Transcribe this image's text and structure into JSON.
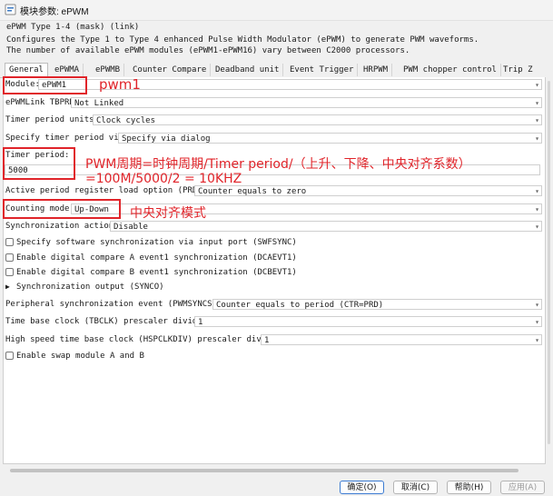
{
  "window": {
    "title": "模块参数: ePWM"
  },
  "mask": {
    "header": "ePWM Type 1-4 (mask) (link)",
    "desc1": "Configures the Type 1 to Type 4 enhanced Pulse Width Modulator (ePWM) to generate PWM waveforms.",
    "desc2": "The number of available ePWM modules (ePWM1-ePWM16) vary between C2000 processors."
  },
  "tabs": [
    "General",
    "ePWMA",
    "ePWMB",
    "Counter Compare",
    "Deadband unit",
    "Event Trigger",
    "HRPWM",
    "PWM chopper control",
    "Trip Z"
  ],
  "form": {
    "module": {
      "label": "Module:",
      "value": "ePWM1"
    },
    "link_tbprd": {
      "label": "ePWMLink TBPRD",
      "value": "Not Linked"
    },
    "timer_period_units": {
      "label": "Timer period units:",
      "value": "Clock cycles"
    },
    "specify_timer_period": {
      "label": "Specify timer period via:",
      "value": "Specify via dialog"
    },
    "timer_period": {
      "label": "Timer period:",
      "value": "5000"
    },
    "active_period_load": {
      "label": "Active period register load option (PRDLD)",
      "value": "Counter equals to zero"
    },
    "counting_mode": {
      "label": "Counting mode:",
      "value": "Up-Down"
    },
    "sync_action": {
      "label": "Synchronization action:",
      "value": "Disable"
    },
    "chk_swfsync": "Specify software synchronization via input port (SWFSYNC)",
    "chk_dcaevt1": "Enable digital compare A event1 synchronization (DCAEVT1)",
    "chk_dcbevt1": "Enable digital compare B event1 synchronization (DCBEVT1)",
    "sync_output": "Synchronization output (SYNCO)",
    "pwmsyncsel": {
      "label": "Peripheral synchronization event (PWMSYNCSEL):",
      "value": "Counter equals to period (CTR=PRD)"
    },
    "tbclk": {
      "label": "Time base clock (TBCLK) prescaler divider:",
      "value": "1"
    },
    "hspclkdiv": {
      "label": "High speed time base clock (HSPCLKDIV) prescaler divider:",
      "value": "1"
    },
    "chk_swap": "Enable swap module A and B"
  },
  "annotations": {
    "pwm1": "pwm1",
    "period_line1": "PWM周期=时钟周期/Timer period/（上升、下降、中央对齐系数）",
    "period_line2": "=100M/5000/2 = 10KHZ",
    "center": "中央对齐模式",
    "color": "#e0242a"
  },
  "buttons": {
    "ok": "确定(O)",
    "cancel": "取消(C)",
    "help": "帮助(H)",
    "apply": "应用(A)"
  }
}
